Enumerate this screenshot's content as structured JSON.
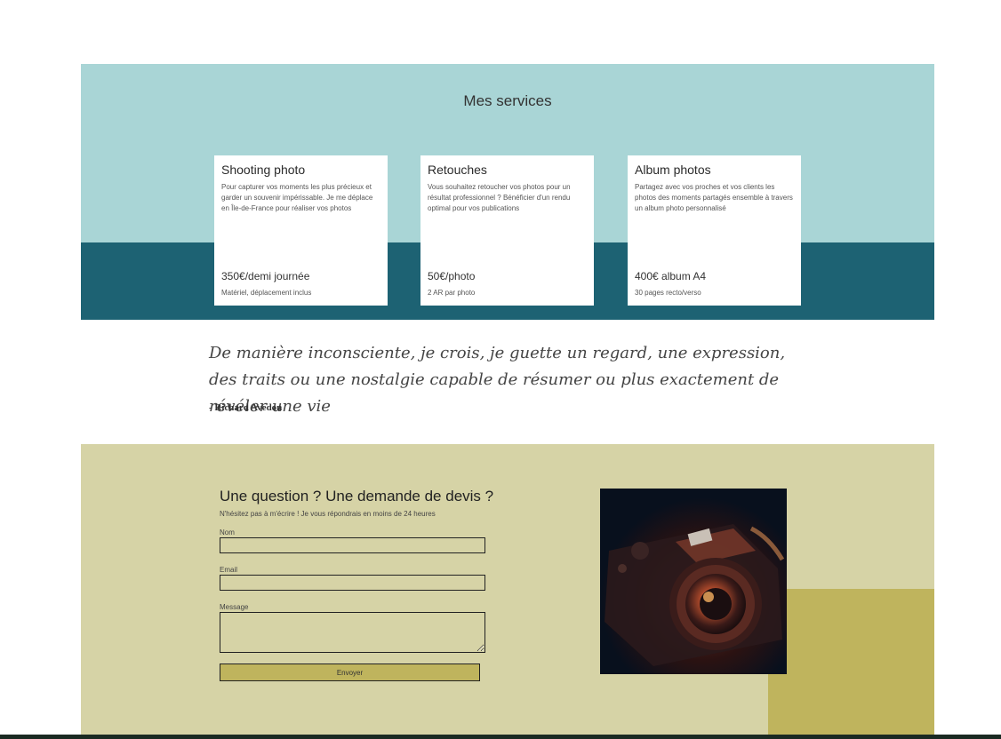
{
  "services": {
    "title": "Mes services",
    "cards": [
      {
        "title": "Shooting photo",
        "description": "Pour capturer vos moments les plus précieux et garder un souvenir impérissable. Je me déplace en Île-de-France pour réaliser vos photos",
        "price": "350€/demi journée",
        "note": "Matériel, déplacement inclus"
      },
      {
        "title": "Retouches",
        "description": "Vous souhaitez retoucher vos photos pour un résultat professionnel ? Bénéficier d'un rendu optimal pour vos publications",
        "price": "50€/photo",
        "note": "2 AR par photo"
      },
      {
        "title": "Album photos",
        "description": "Partagez avec vos proches et vos clients les photos des moments partagés ensemble à travers un album photo personnalisé",
        "price": "400€ album A4",
        "note": "30 pages recto/verso"
      }
    ]
  },
  "quote": {
    "text": "De manière inconsciente, je crois, je guette un regard, une expression, des traits ou une nostalgie capable de résumer ou plus exactement de révéler une vie",
    "author": "- Richard Avedon"
  },
  "contact": {
    "heading": "Une question ? Une demande de devis ?",
    "subheading": "N'hésitez pas à m'écrire ! Je vous répondrais en moins de 24 heures",
    "fields": {
      "name_label": "Nom",
      "email_label": "Email",
      "message_label": "Message"
    },
    "submit_label": "Envoyer",
    "photo_icon": "camera-photo"
  },
  "colors": {
    "services_bg": "#a9d5d6",
    "services_band": "#1d6273",
    "contact_bg": "#d6d3a6",
    "accent": "#bfb45d"
  }
}
